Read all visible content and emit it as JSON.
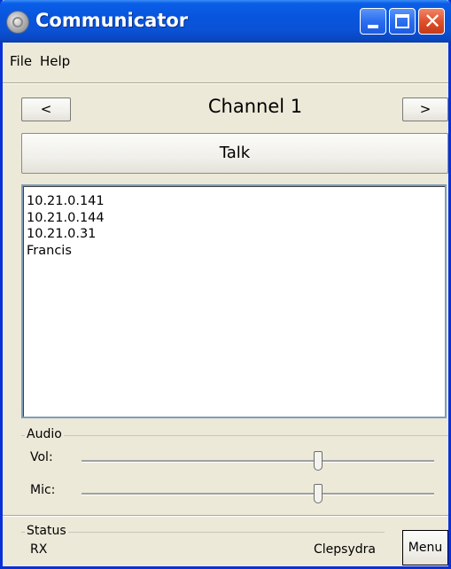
{
  "window": {
    "title": "Communicator"
  },
  "menu": {
    "items": [
      "File",
      "Help"
    ]
  },
  "channel": {
    "prev_label": "<",
    "name": "Channel 1",
    "next_label": ">"
  },
  "talk_label": "Talk",
  "participants": [
    "10.21.0.141",
    "10.21.0.144",
    "10.21.0.31",
    "Francis"
  ],
  "audio": {
    "group_label": "Audio",
    "vol_label": "Vol:",
    "mic_label": "Mic:",
    "vol_level": 0.67,
    "mic_level": 0.67
  },
  "status": {
    "group_label": "Status",
    "value": "RX",
    "app_name": "Clepsydra",
    "menu_label": "Menu"
  },
  "colors": {
    "titlebar": "#0a52d6",
    "window_bg": "#ece9d8",
    "close_button": "#e0502c",
    "listbox_border": "#7f9db9"
  }
}
